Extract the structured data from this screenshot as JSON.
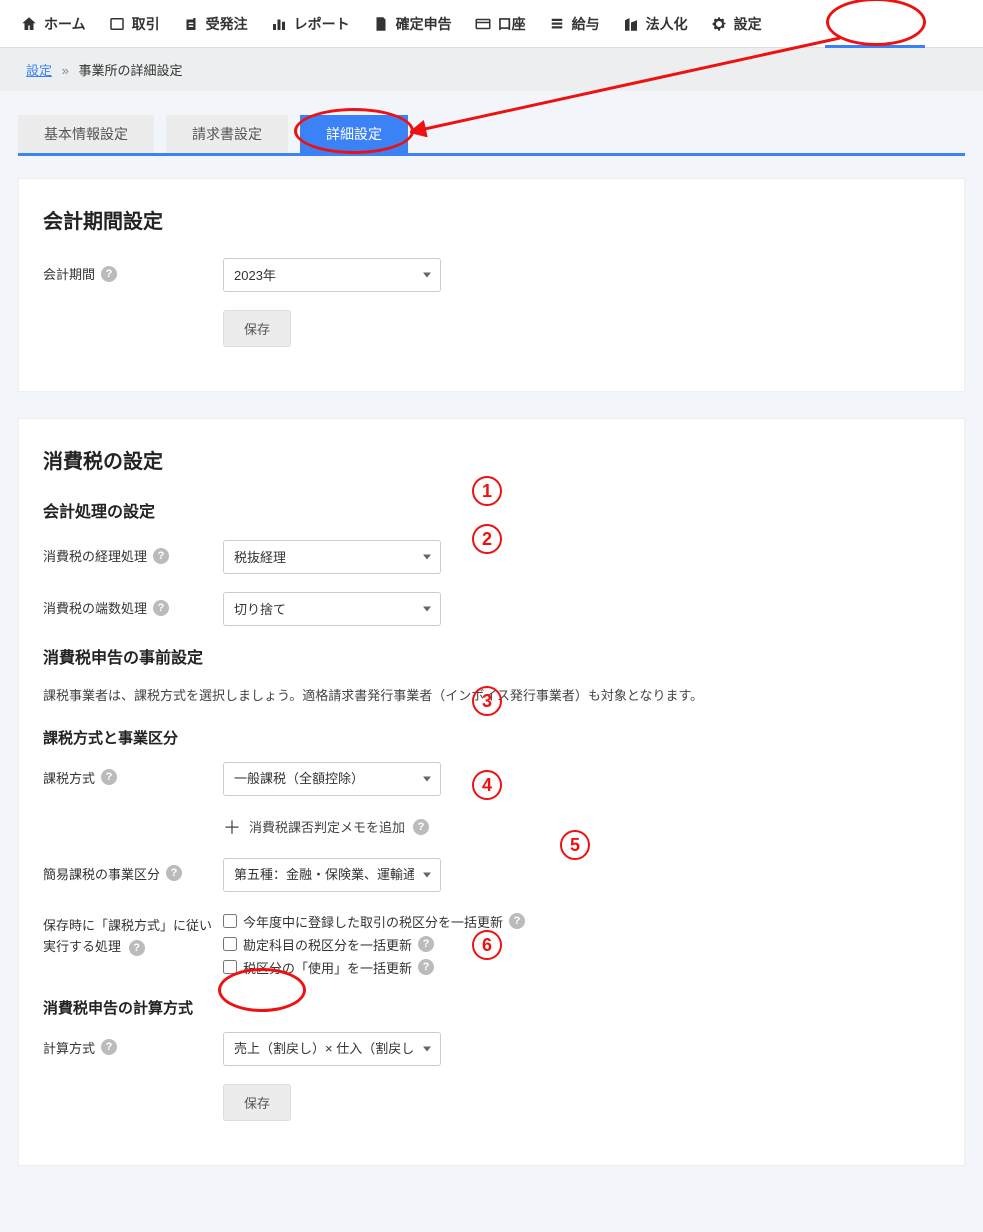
{
  "nav": {
    "items": [
      {
        "label": "ホーム",
        "icon": "home"
      },
      {
        "label": "取引",
        "icon": "square"
      },
      {
        "label": "受発注",
        "icon": "doc-list"
      },
      {
        "label": "レポート",
        "icon": "chart"
      },
      {
        "label": "確定申告",
        "icon": "file-check"
      },
      {
        "label": "口座",
        "icon": "card"
      },
      {
        "label": "給与",
        "icon": "list"
      },
      {
        "label": "法人化",
        "icon": "building"
      },
      {
        "label": "設定",
        "icon": "gear"
      }
    ]
  },
  "breadcrumb": {
    "link": "設定",
    "sep": "»",
    "current": "事業所の詳細設定"
  },
  "tabs": {
    "basic": "基本情報設定",
    "invoice": "請求書設定",
    "detail": "詳細設定"
  },
  "card1": {
    "title": "会計期間設定",
    "period_label": "会計期間",
    "period_value": "2023年",
    "save": "保存"
  },
  "card2": {
    "title": "消費税の設定",
    "h_proc": "会計処理の設定",
    "row1_label": "消費税の経理処理",
    "row1_value": "税抜経理",
    "row2_label": "消費税の端数処理",
    "row2_value": "切り捨て",
    "h_filing": "消費税申告の事前設定",
    "note": "課税事業者は、課税方式を選択しましょう。適格請求書発行事業者（インボイス発行事業者）も対象となります。",
    "h_taxtype": "課税方式と事業区分",
    "row3_label": "課税方式",
    "row3_value": "一般課税（全額控除）",
    "addmemo": "消費税課否判定メモを追加",
    "row4_label": "簡易課税の事業区分",
    "row4_value": "第五種：金融・保険業、運輸通信",
    "row5_label1": "保存時に「課税方式」に従い",
    "row5_label2": "実行する処理",
    "cb1": "今年度中に登録した取引の税区分を一括更新",
    "cb2": "勘定科目の税区分を一括更新",
    "cb3": "税区分の「使用」を一括更新",
    "h_calc": "消費税申告の計算方式",
    "row6_label": "計算方式",
    "row6_value": "売上（割戻し）× 仕入（割戻し）",
    "save": "保存"
  },
  "annot": {
    "n1": "1",
    "n2": "2",
    "n3": "3",
    "n4": "4",
    "n5": "5",
    "n6": "6"
  }
}
